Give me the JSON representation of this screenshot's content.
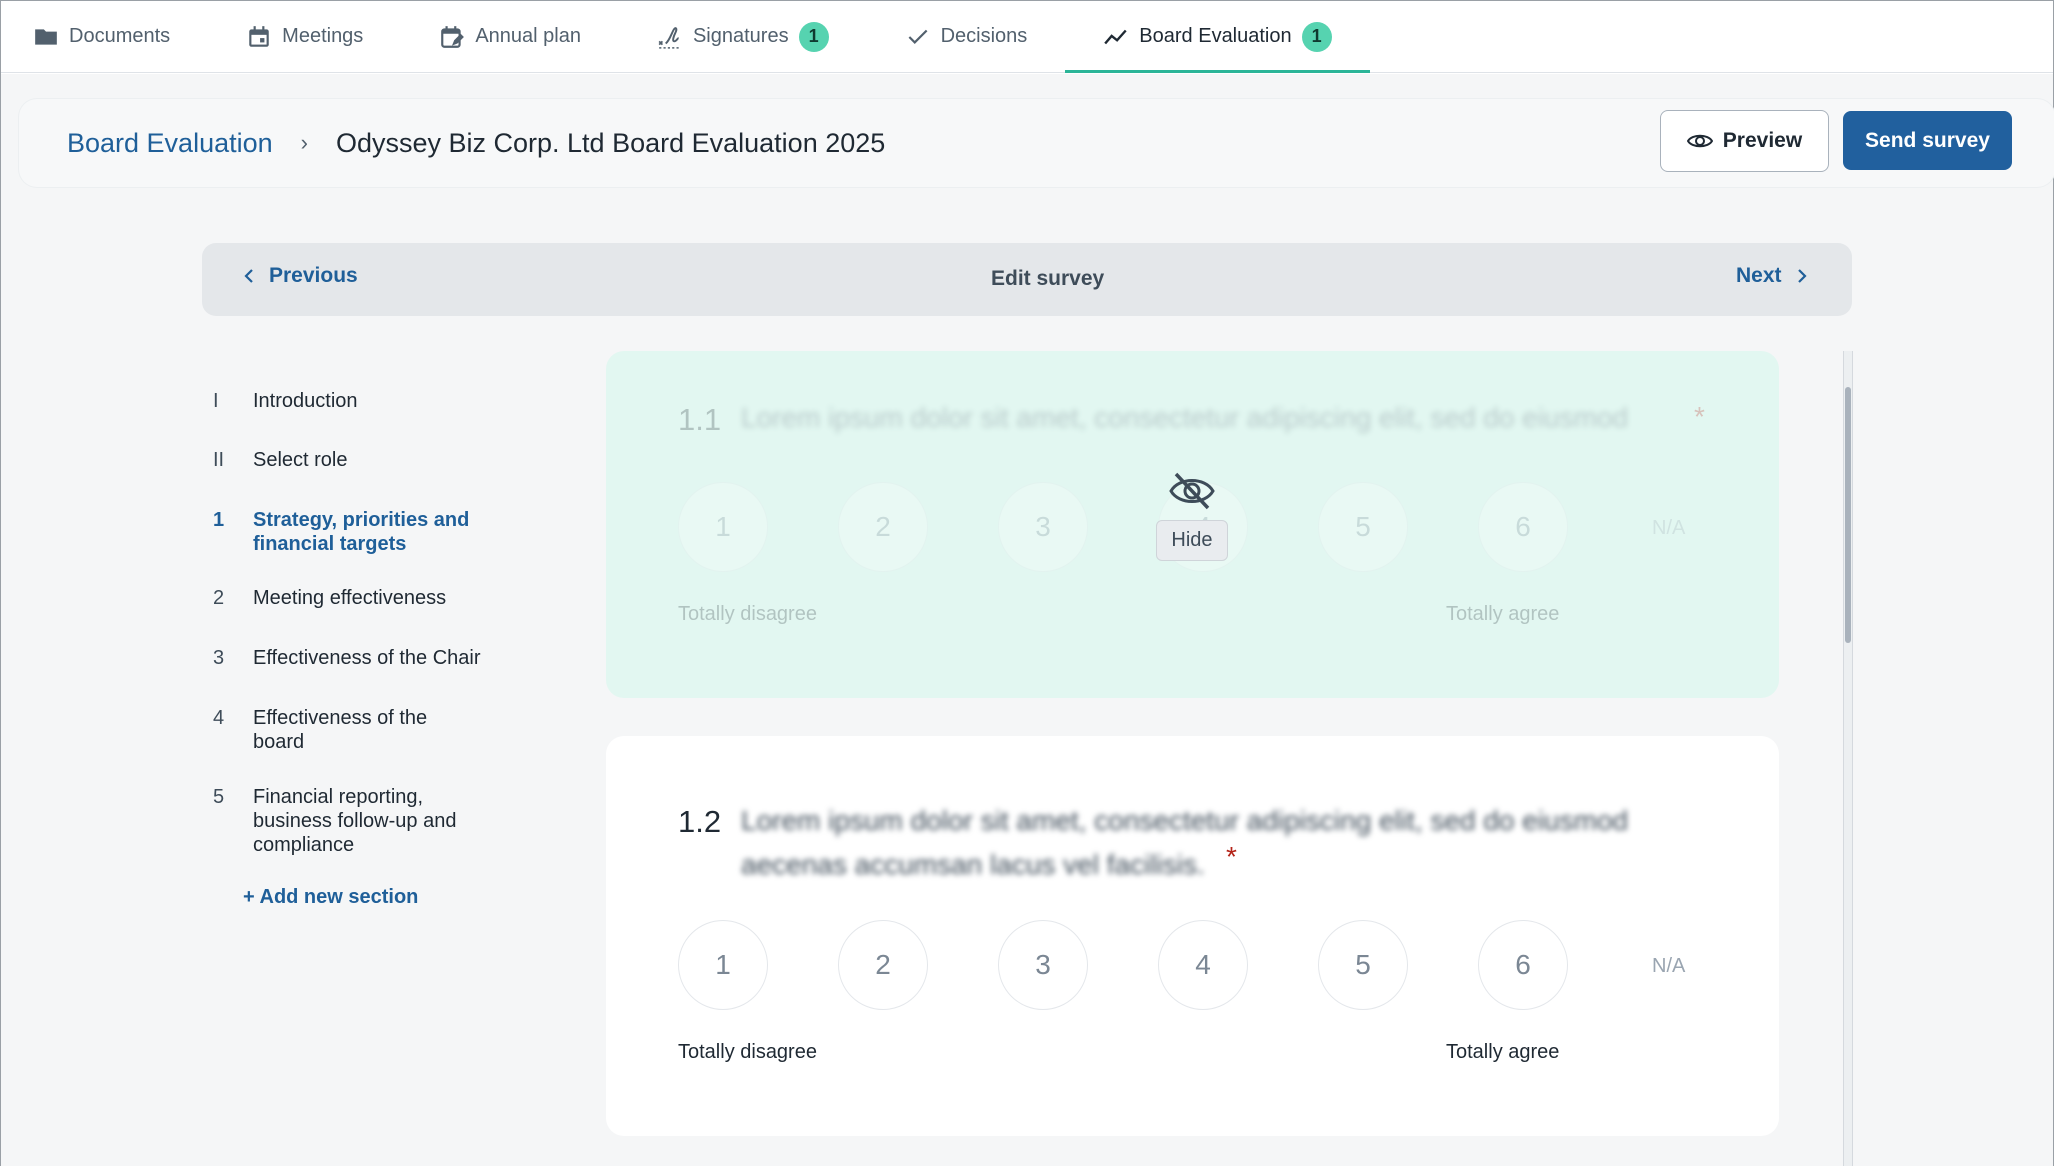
{
  "tabs": [
    {
      "label": "Documents",
      "icon": "folder-icon",
      "badge": ""
    },
    {
      "label": "Meetings",
      "icon": "calendar-icon",
      "badge": ""
    },
    {
      "label": "Annual plan",
      "icon": "calendar-edit-icon",
      "badge": ""
    },
    {
      "label": "Signatures",
      "icon": "signature-icon",
      "badge": "1"
    },
    {
      "label": "Decisions",
      "icon": "checkmark-icon",
      "badge": ""
    },
    {
      "label": "Board Evaluation",
      "icon": "trend-line-icon",
      "badge": "1",
      "active": true
    }
  ],
  "header": {
    "breadcrumb_link": "Board Evaluation",
    "breadcrumb_separator": "›",
    "title": "Odyssey Biz Corp. Ltd Board Evaluation 2025",
    "preview_label": "Preview",
    "send_label": "Send survey"
  },
  "survey_nav": {
    "previous_label": "Previous",
    "title": "Edit survey",
    "next_label": "Next"
  },
  "sections": [
    {
      "num": "I",
      "label": "Introduction"
    },
    {
      "num": "II",
      "label": "Select role"
    },
    {
      "num": "1",
      "label": "Strategy, priorities and financial targets",
      "active": true
    },
    {
      "num": "2",
      "label": "Meeting effectiveness"
    },
    {
      "num": "3",
      "label": "Effectiveness of the Chair"
    },
    {
      "num": "4",
      "label": "Effectiveness of the board"
    },
    {
      "num": "5",
      "label": "Financial reporting, business follow-up and compliance"
    }
  ],
  "add_section_label": "+ Add new section",
  "questions": [
    {
      "number": "1.1",
      "text": "Lorem ipsum dolor sit amet, consectetur adipiscing elit, sed do eiusmod",
      "required_mark": "*",
      "options": [
        "1",
        "2",
        "3",
        "4",
        "5",
        "6"
      ],
      "na_label": "N/A",
      "low_label": "Totally disagree",
      "high_label": "Totally agree",
      "hidden": true,
      "hide_label": "Hide"
    },
    {
      "number": "1.2",
      "text_line1": "Lorem ipsum dolor sit amet, consectetur adipiscing elit, sed do eiusmod",
      "text_line2": "aecenas accumsan lacus vel facilisis.",
      "required_mark": "*",
      "options": [
        "1",
        "2",
        "3",
        "4",
        "5",
        "6"
      ],
      "na_label": "N/A",
      "low_label": "Totally disagree",
      "high_label": "Totally agree",
      "hidden": false
    }
  ],
  "colors": {
    "accent": "#21609e",
    "link": "#1f5f99",
    "tab_active_underline": "#2bb598",
    "badge": "#56d3b0",
    "hidden_card": "#e2f7f1",
    "required": "#b42318"
  }
}
